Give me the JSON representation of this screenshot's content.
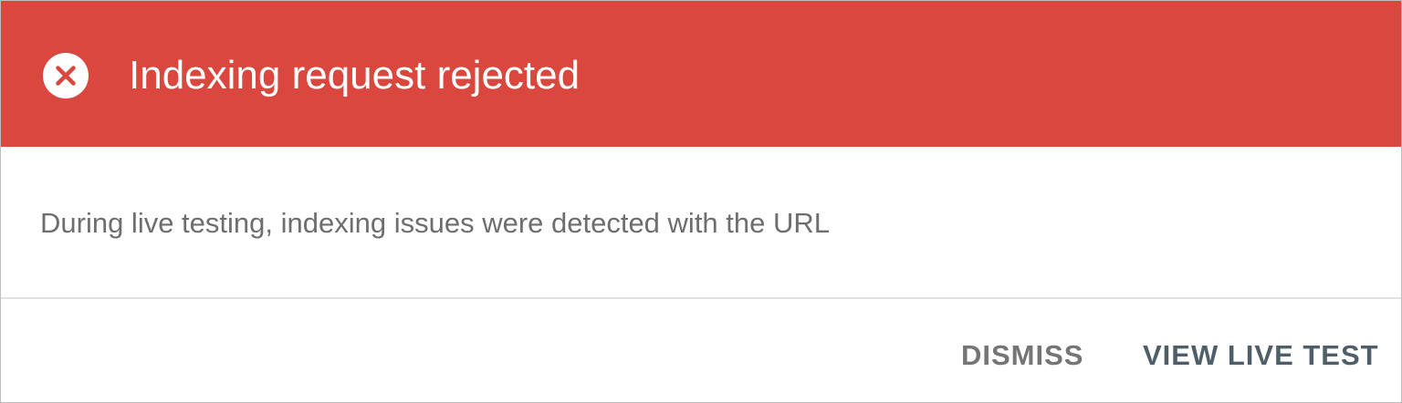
{
  "dialog": {
    "title": "Indexing request rejected",
    "message": "During live testing, indexing issues were detected with the URL",
    "icon": "error-circle-icon"
  },
  "actions": {
    "dismiss_label": "DISMISS",
    "view_live_test_label": "VIEW LIVE TEST"
  },
  "colors": {
    "header_background": "#d9473f",
    "title_text": "#ffffff",
    "message_text": "#6e6e6e",
    "dismiss_text": "#757575",
    "primary_action_text": "#4f5f69"
  }
}
